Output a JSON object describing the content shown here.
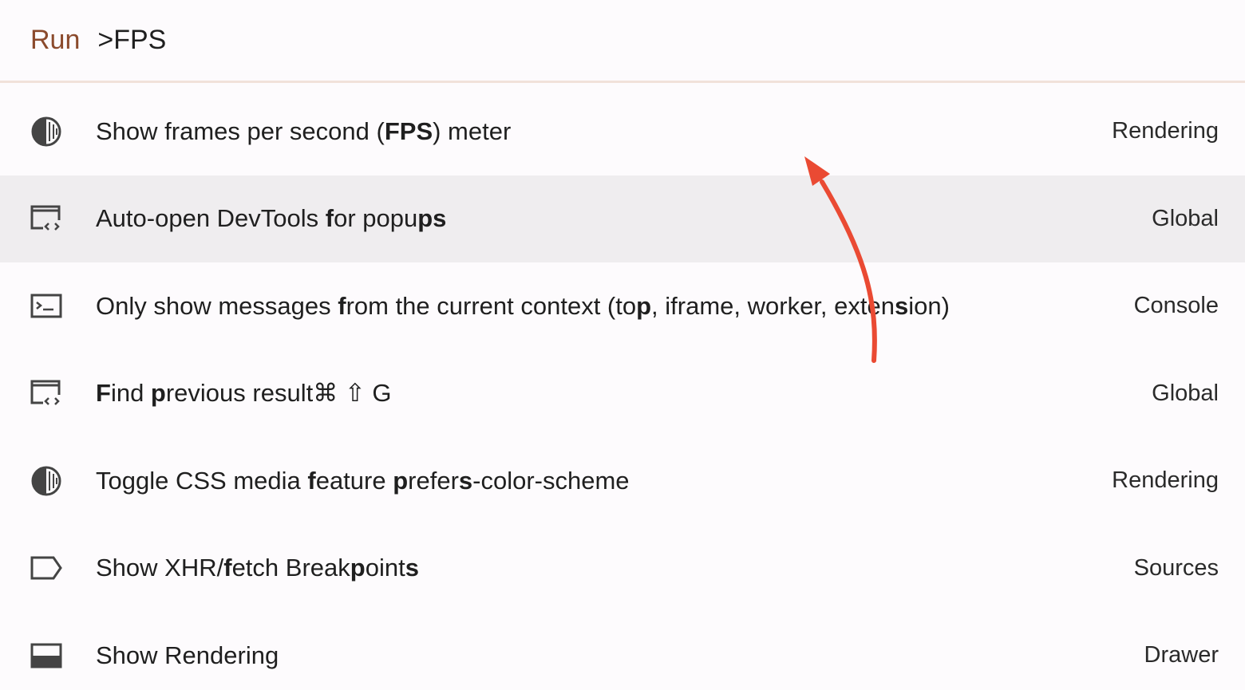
{
  "prompt": {
    "prefix": "Run",
    "query": ">FPS"
  },
  "results": [
    {
      "icon": "rendering-icon",
      "title_parts": [
        {
          "text": "Show frames per second (",
          "bold": false
        },
        {
          "text": "FPS",
          "bold": true
        },
        {
          "text": ") meter",
          "bold": false
        }
      ],
      "category": "Rendering"
    },
    {
      "icon": "devtools-window-icon",
      "title_parts": [
        {
          "text": "Auto-open DevTools ",
          "bold": false
        },
        {
          "text": "f",
          "bold": true
        },
        {
          "text": "or popu",
          "bold": false
        },
        {
          "text": "ps",
          "bold": true
        }
      ],
      "category": "Global"
    },
    {
      "icon": "console-icon",
      "title_parts": [
        {
          "text": "Only show messages ",
          "bold": false
        },
        {
          "text": "f",
          "bold": true
        },
        {
          "text": "rom the current context (to",
          "bold": false
        },
        {
          "text": "p",
          "bold": true
        },
        {
          "text": ", iframe, worker, exten",
          "bold": false
        },
        {
          "text": "s",
          "bold": true
        },
        {
          "text": "ion)",
          "bold": false
        }
      ],
      "category": "Console"
    },
    {
      "icon": "devtools-window-icon",
      "title_parts": [
        {
          "text": "F",
          "bold": true
        },
        {
          "text": "ind ",
          "bold": false
        },
        {
          "text": "p",
          "bold": true
        },
        {
          "text": "revious result",
          "bold": false
        },
        {
          "text": "⌘ ⇧ G",
          "bold": false
        }
      ],
      "category": "Global"
    },
    {
      "icon": "rendering-icon",
      "title_parts": [
        {
          "text": "Toggle CSS media ",
          "bold": false
        },
        {
          "text": "f",
          "bold": true
        },
        {
          "text": "eature ",
          "bold": false
        },
        {
          "text": "p",
          "bold": true
        },
        {
          "text": "refer",
          "bold": false
        },
        {
          "text": "s",
          "bold": true
        },
        {
          "text": "-color-scheme",
          "bold": false
        }
      ],
      "category": "Rendering"
    },
    {
      "icon": "breakpoint-tag-icon",
      "title_parts": [
        {
          "text": "Show XHR/",
          "bold": false
        },
        {
          "text": "f",
          "bold": true
        },
        {
          "text": "etch Break",
          "bold": false
        },
        {
          "text": "p",
          "bold": true
        },
        {
          "text": "oint",
          "bold": false
        },
        {
          "text": "s",
          "bold": true
        }
      ],
      "category": "Sources"
    },
    {
      "icon": "drawer-icon",
      "title_parts": [
        {
          "text": "Show Rendering",
          "bold": false
        }
      ],
      "category": "Drawer"
    }
  ],
  "selected_index": 1,
  "colors": {
    "prefix": "#8b4a2c",
    "selected_row": "#efedef",
    "annotation_arrow": "#ea4a33"
  }
}
